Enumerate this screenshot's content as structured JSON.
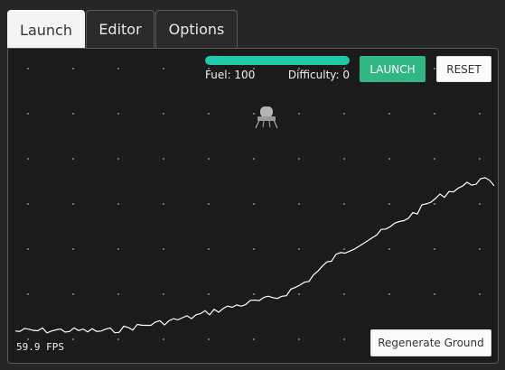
{
  "tabs": [
    {
      "label": "Launch",
      "active": true
    },
    {
      "label": "Editor",
      "active": false
    },
    {
      "label": "Options",
      "active": false
    }
  ],
  "hud": {
    "fuel_label": "Fuel: 100",
    "fuel_fraction": 1.0,
    "difficulty_label": "Difficulty: 0"
  },
  "buttons": {
    "launch": "LAUNCH",
    "reset": "RESET",
    "regenerate": "Regenerate Ground"
  },
  "fps": "59.9 FPS",
  "colors": {
    "accent": "#1fc9a9",
    "launch_button": "#31b784",
    "panel_bg": "#1b1b1b",
    "terrain": "#ffffff"
  },
  "icons": {
    "lander": "lander-icon"
  }
}
